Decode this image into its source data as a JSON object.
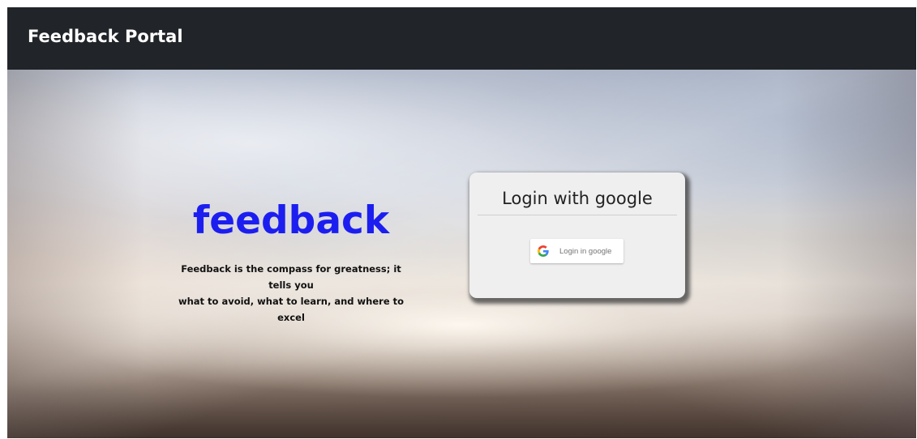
{
  "navbar": {
    "brand": "Feedback Portal"
  },
  "hero": {
    "title": "feedback",
    "tagline_line1": "Feedback is the compass for greatness; it tells you",
    "tagline_line2": "what to avoid, what to learn, and where to excel"
  },
  "login": {
    "heading": "Login with google",
    "google_button_label": "Login in google",
    "google_icon": "google-g-icon"
  },
  "colors": {
    "navbar_bg": "#212529",
    "title_color": "#1c1ef0",
    "card_bg": "#efefef"
  }
}
